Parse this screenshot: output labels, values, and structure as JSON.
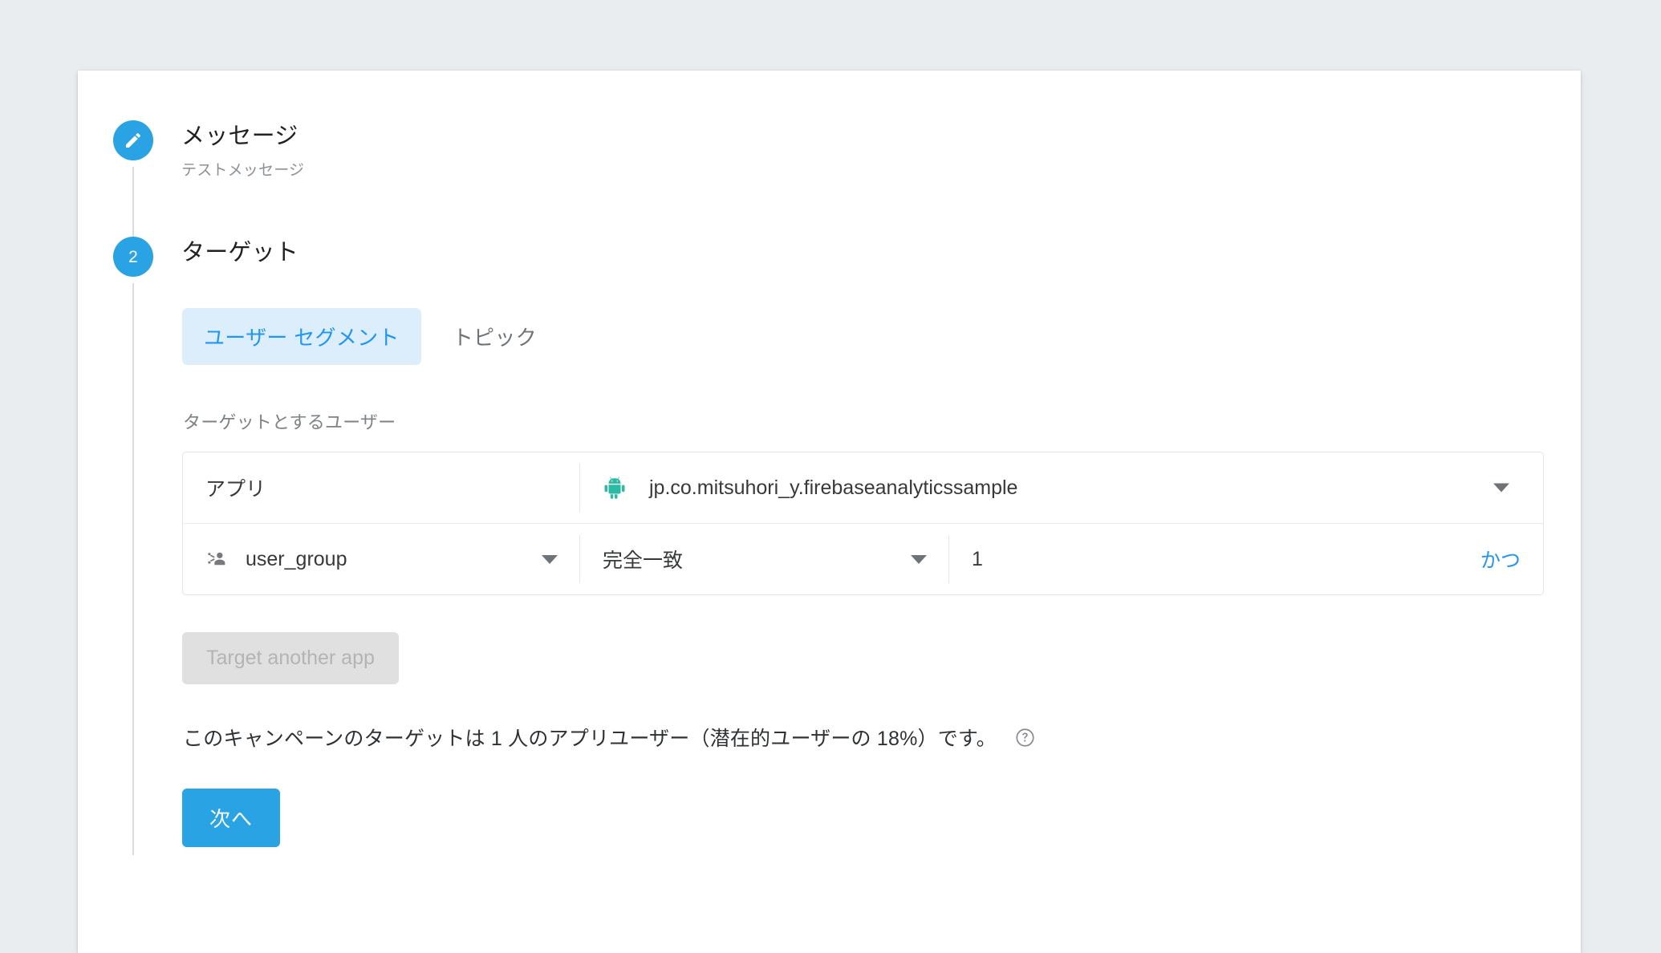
{
  "theme": {
    "page_background": "#e9edf0",
    "card_background": "#ffffff",
    "accent_blue": "#29a3e3",
    "link_blue": "#2196f3",
    "tab_active_background": "#dcedfb",
    "android_green": "#2bbba4",
    "disabled_button_background": "#e0e0e0",
    "disabled_button_text": "#b4b4b4"
  },
  "steps": {
    "message": {
      "marker_icon": "pencil-icon",
      "title": "メッセージ",
      "subtitle": "テストメッセージ"
    },
    "target": {
      "number": "2",
      "title": "ターゲット"
    }
  },
  "tabs": [
    {
      "label": "ユーザー セグメント",
      "active": true
    },
    {
      "label": "トピック",
      "active": false
    }
  ],
  "target_section": {
    "field_label": "ターゲットとするユーザー",
    "app_row": {
      "label": "アプリ",
      "app_icon": "android-icon",
      "app_package": "jp.co.mitsuhori_y.firebaseanalyticssample",
      "caret_icon": "chevron-down-icon"
    },
    "condition_row": {
      "dimension_icon": "user-group-icon",
      "dimension": "user_group",
      "dimension_caret": "chevron-down-icon",
      "operator": "完全一致",
      "operator_caret": "chevron-down-icon",
      "value": "1",
      "and_link": "かつ"
    },
    "target_another_app_button": "Target another app",
    "summary_text": "このキャンペーンのターゲットは 1 人のアプリユーザー（潜在的ユーザーの 18%）です。",
    "summary_help_icon": "help-circle-icon",
    "next_button": "次へ"
  }
}
